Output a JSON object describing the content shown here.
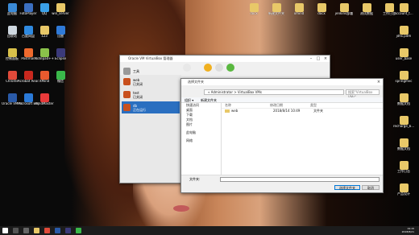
{
  "desktop": {
    "icons": [
      {
        "label": "此电脑",
        "color": "#3a8ad6"
      },
      {
        "label": "FotoPlayer",
        "color": "#3b6fc0"
      },
      {
        "label": "QQ",
        "color": "#3aa0e8"
      },
      {
        "label": "win_server",
        "color": "#e8c868"
      },
      {
        "label": "回收站",
        "color": "#cfd8e0"
      },
      {
        "label": "百度网盘",
        "color": "#2f8ae0"
      },
      {
        "label": "123",
        "color": "#e8c868"
      },
      {
        "label": "迅雷",
        "color": "#2f7ad8"
      },
      {
        "label": "控制面板",
        "color": "#d8c04a"
      },
      {
        "label": "Postman",
        "color": "#ef6a2e"
      },
      {
        "label": "Notepad++",
        "color": "#8ac24a"
      },
      {
        "label": "Eclipse",
        "color": "#3b3a7a"
      },
      {
        "label": "Chrome",
        "color": "#e04a3a"
      },
      {
        "label": "Acrobat Reader DC",
        "color": "#c8281e"
      },
      {
        "label": "XMind",
        "color": "#e85a2e"
      },
      {
        "label": "微信",
        "color": "#3ab84a"
      },
      {
        "label": "Oracle VM VirtualBox",
        "color": "#2a5aa8"
      },
      {
        "label": "Microsoft Edge",
        "color": "#2a7ad8"
      },
      {
        "label": "MindMaster",
        "color": "#e83a3a"
      }
    ],
    "right_icons": [
      {
        "label": "account_t...",
        "color": "#e8c868"
      },
      {
        "label": "jdhs.pdm",
        "color": "#e8c868"
      },
      {
        "label": "user_base",
        "color": "#e8c868"
      },
      {
        "label": "springmvc",
        "color": "#e8c868"
      },
      {
        "label": "数据文档",
        "color": "#e8c868"
      },
      {
        "label": "recharge_b...",
        "color": "#e8c868"
      },
      {
        "label": "数据文档",
        "color": "#e8c868"
      },
      {
        "label": "工作日志",
        "color": "#e8c868"
      },
      {
        "label": "产品设计",
        "color": "#e8c868"
      }
    ],
    "top_icons": [
      {
        "label": "docx",
        "color": "#e8c868"
      },
      {
        "label": "新建文件夹",
        "color": "#e8c868"
      },
      {
        "label": "xmind",
        "color": "#e8c868"
      },
      {
        "label": "docx",
        "color": "#e8c868"
      },
      {
        "label": "jenkins部署",
        "color": "#e8c868"
      },
      {
        "label": "测试数据",
        "color": "#e8c868"
      },
      {
        "label": "工作日志",
        "color": "#e8c868"
      }
    ]
  },
  "virtualbox": {
    "title": "Oracle VM VirtualBox 管理器",
    "tools_label": "工具",
    "vms": [
      {
        "name": "web",
        "status": "已关闭"
      },
      {
        "name": "test",
        "status": "已关闭"
      },
      {
        "name": "db",
        "status": "正在运行"
      }
    ]
  },
  "dialog": {
    "title": "选择文件夹",
    "address": "« Administrator > VirtualBox VMs",
    "search_placeholder": "搜索\"VirtualBox VMs\"",
    "organize": "组织 ▾",
    "new_folder": "新建文件夹",
    "nav": [
      "快速访问",
      "桌面",
      "下载",
      "文档",
      "图片",
      "此电脑",
      "网络"
    ],
    "columns": [
      "名称",
      "修改日期",
      "类型"
    ],
    "files": [
      {
        "name": "web",
        "date": "2018/8/14 10:49",
        "type": "文件夹"
      }
    ],
    "folder_label": "文件夹:",
    "select_button": "选择文件夹",
    "cancel_button": "取消"
  },
  "taskbar": {
    "time": "19:15",
    "date": "2018/8/21"
  }
}
